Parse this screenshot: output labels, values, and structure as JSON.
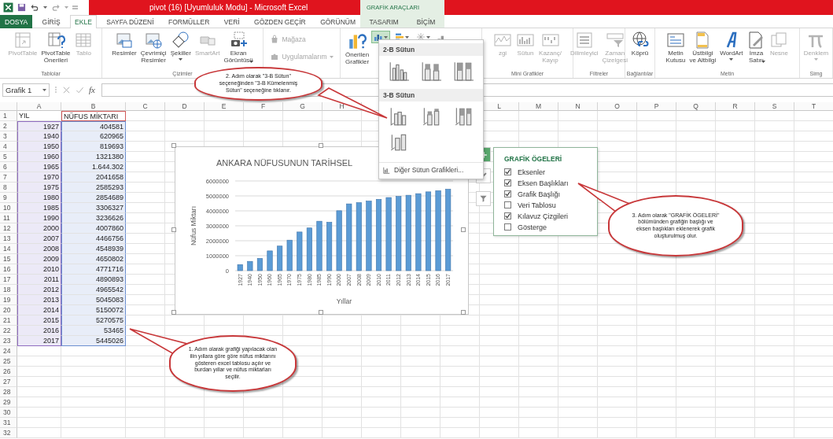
{
  "window": {
    "title": "pivot (16) [Uyumluluk Modu] - Microsoft Excel",
    "context_header": "GRAFİK ARAÇLARI"
  },
  "tabs": [
    {
      "label": "DOSYA",
      "kind": "file",
      "selected": false
    },
    {
      "label": "GİRİŞ",
      "kind": "normal",
      "selected": false
    },
    {
      "label": "EKLE",
      "kind": "normal",
      "selected": true
    },
    {
      "label": "SAYFA DÜZENİ",
      "kind": "normal",
      "selected": false
    },
    {
      "label": "FORMÜLLER",
      "kind": "normal",
      "selected": false
    },
    {
      "label": "VERİ",
      "kind": "normal",
      "selected": false
    },
    {
      "label": "GÖZDEN GEÇİR",
      "kind": "normal",
      "selected": false
    },
    {
      "label": "GÖRÜNÜM",
      "kind": "normal",
      "selected": false
    },
    {
      "label": "TASARIM",
      "kind": "contextual",
      "selected": false
    },
    {
      "label": "BİÇİM",
      "kind": "contextual",
      "selected": false
    }
  ],
  "ribbon": {
    "groups": [
      {
        "kind": "large",
        "label": "Tablolar",
        "buttons": [
          {
            "label": "PivotTable",
            "disabled": true,
            "dropdown": false
          },
          {
            "label": "PivotTable\nÖnerileri",
            "disabled": false,
            "dropdown": false
          },
          {
            "label": "Tablo",
            "disabled": true,
            "dropdown": false
          }
        ]
      },
      {
        "kind": "large",
        "label": "Çizimler",
        "buttons": [
          {
            "label": "Resimler",
            "disabled": false,
            "dropdown": false
          },
          {
            "label": "Çevrimiçi\nResimler",
            "disabled": false,
            "dropdown": false
          },
          {
            "label": "Şekiller",
            "disabled": false,
            "dropdown": true
          },
          {
            "label": "SmartArt",
            "disabled": true,
            "dropdown": false
          },
          {
            "label": "Ekran\nGörüntüsü",
            "disabled": false,
            "dropdown": true
          }
        ]
      },
      {
        "kind": "apps",
        "buttons": [
          {
            "label": "Mağaza",
            "disabled": true,
            "dropdown": false
          },
          {
            "label": "Uygulamalarım",
            "disabled": true,
            "dropdown": true
          }
        ]
      },
      {
        "kind": "charts",
        "buttons": [
          {
            "label": "Önerilen\nGrafikler",
            "disabled": false,
            "dropdown": false
          }
        ],
        "chart_buttons": [
          {
            "expanded": true
          },
          {
            "expanded": false
          },
          {
            "expanded": false
          }
        ]
      },
      {
        "kind": "large",
        "label": "Mini Grafikler",
        "buttons": [
          {
            "label": "zgi",
            "disabled": true,
            "dropdown": false
          },
          {
            "label": "Sütun",
            "disabled": true,
            "dropdown": false
          },
          {
            "label": "Kazanç/\nKayıp",
            "disabled": true,
            "dropdown": false
          }
        ]
      },
      {
        "kind": "large",
        "label": "Filtreler",
        "buttons": [
          {
            "label": "Dilimleyici",
            "disabled": true,
            "dropdown": false
          },
          {
            "label": "Zaman\nÇizelgesi",
            "disabled": true,
            "dropdown": false
          }
        ]
      },
      {
        "kind": "large",
        "label": "Bağlantılar",
        "buttons": [
          {
            "label": "Köprü",
            "disabled": false,
            "dropdown": false
          }
        ]
      },
      {
        "kind": "large",
        "label": "Metin",
        "buttons": [
          {
            "label": "Metin\nKutusu",
            "disabled": false,
            "dropdown": false
          },
          {
            "label": "Üstbilgi\nve Altbilgi",
            "disabled": false,
            "dropdown": false
          },
          {
            "label": "WordArt",
            "disabled": false,
            "dropdown": true
          },
          {
            "label": "İmza\nSatırı",
            "disabled": false,
            "dropdown": true
          },
          {
            "label": "Nesne",
            "disabled": true,
            "dropdown": false
          }
        ]
      },
      {
        "kind": "large",
        "label": "Simg",
        "buttons": [
          {
            "label": "Denklem",
            "disabled": true,
            "dropdown": true
          }
        ]
      }
    ]
  },
  "formula_bar": {
    "name_box": "Grafik 1",
    "fx_label": "fx"
  },
  "chart_menu": {
    "sections": [
      {
        "title": "2-B Sütun",
        "options": [
          {
            "kind": "clustered"
          },
          {
            "kind": "stacked"
          },
          {
            "kind": "full"
          }
        ]
      },
      {
        "title": "3-B Sütun",
        "options": [
          {
            "kind": "clustered3d"
          },
          {
            "kind": "stacked3d"
          },
          {
            "kind": "full3d"
          },
          {
            "kind": "column3d"
          }
        ]
      }
    ],
    "footer": "Diğer Sütun Grafikleri..."
  },
  "sheet": {
    "columns_left": [
      "A",
      "B",
      "C",
      "D",
      "E",
      "F",
      "G",
      "H"
    ],
    "columns_right": [
      "L",
      "M",
      "N",
      "O",
      "P",
      "Q",
      "R",
      "S",
      "T"
    ],
    "rows": [
      {
        "number": "1",
        "kind": "header",
        "highlighted": true,
        "cells": [
          "YIL",
          "NÜFUS MİKTARI"
        ]
      },
      {
        "number": "2",
        "kind": "data",
        "highlighted": true,
        "cells": [
          "1927",
          "404581"
        ]
      },
      {
        "number": "3",
        "kind": "data",
        "highlighted": true,
        "cells": [
          "1940",
          "620965"
        ]
      },
      {
        "number": "4",
        "kind": "data",
        "highlighted": true,
        "cells": [
          "1950",
          "819693"
        ]
      },
      {
        "number": "5",
        "kind": "data",
        "highlighted": true,
        "cells": [
          "1960",
          "1321380"
        ]
      },
      {
        "number": "6",
        "kind": "data",
        "highlighted": true,
        "cells": [
          "1965",
          "1.644.302"
        ]
      },
      {
        "number": "7",
        "kind": "data",
        "highlighted": true,
        "cells": [
          "1970",
          "2041658"
        ]
      },
      {
        "number": "8",
        "kind": "data",
        "highlighted": true,
        "cells": [
          "1975",
          "2585293"
        ]
      },
      {
        "number": "9",
        "kind": "data",
        "highlighted": true,
        "cells": [
          "1980",
          "2854689"
        ]
      },
      {
        "number": "10",
        "kind": "data",
        "highlighted": true,
        "cells": [
          "1985",
          "3306327"
        ]
      },
      {
        "number": "11",
        "kind": "data",
        "highlighted": true,
        "cells": [
          "1990",
          "3236626"
        ]
      },
      {
        "number": "12",
        "kind": "data",
        "highlighted": true,
        "cells": [
          "2000",
          "4007860"
        ]
      },
      {
        "number": "13",
        "kind": "data",
        "highlighted": true,
        "cells": [
          "2007",
          "4466756"
        ]
      },
      {
        "number": "14",
        "kind": "data",
        "highlighted": true,
        "cells": [
          "2008",
          "4548939"
        ]
      },
      {
        "number": "15",
        "kind": "data",
        "highlighted": true,
        "cells": [
          "2009",
          "4650802"
        ]
      },
      {
        "number": "16",
        "kind": "data",
        "highlighted": true,
        "cells": [
          "2010",
          "4771716"
        ]
      },
      {
        "number": "17",
        "kind": "data",
        "highlighted": true,
        "cells": [
          "2011",
          "4890893"
        ]
      },
      {
        "number": "18",
        "kind": "data",
        "highlighted": true,
        "cells": [
          "2012",
          "4965542"
        ]
      },
      {
        "number": "19",
        "kind": "data",
        "highlighted": true,
        "cells": [
          "2013",
          "5045083"
        ]
      },
      {
        "number": "20",
        "kind": "data",
        "highlighted": true,
        "cells": [
          "2014",
          "5150072"
        ]
      },
      {
        "number": "21",
        "kind": "data",
        "highlighted": true,
        "cells": [
          "2015",
          "5270575"
        ]
      },
      {
        "number": "22",
        "kind": "data",
        "highlighted": true,
        "cells": [
          "2016",
          "53465"
        ]
      },
      {
        "number": "23",
        "kind": "data",
        "highlighted": true,
        "cells": [
          "2017",
          "5445026"
        ]
      },
      {
        "number": "24",
        "kind": "empty",
        "highlighted": false
      },
      {
        "number": "25",
        "kind": "empty",
        "highlighted": false
      },
      {
        "number": "26",
        "kind": "empty",
        "highlighted": false
      },
      {
        "number": "27",
        "kind": "empty",
        "highlighted": false
      },
      {
        "number": "28",
        "kind": "empty",
        "highlighted": false
      },
      {
        "number": "29",
        "kind": "empty",
        "highlighted": false
      },
      {
        "number": "30",
        "kind": "empty",
        "highlighted": false
      },
      {
        "number": "31",
        "kind": "empty",
        "highlighted": false
      },
      {
        "number": "32",
        "kind": "empty",
        "highlighted": false
      }
    ]
  },
  "chart": {
    "chart_data": {
      "type": "bar",
      "title": "ANKARA NÜFUSUNUN TARİHSEL",
      "xlabel": "Yıllar",
      "ylabel": "Nüfus Miktarı",
      "categories": [
        "1927",
        "1940",
        "1950",
        "1960",
        "1965",
        "1970",
        "1975",
        "1980",
        "1985",
        "1990",
        "2000",
        "2007",
        "2008",
        "2009",
        "2010",
        "2011",
        "2012",
        "2013",
        "2014",
        "2015",
        "2016",
        "2017"
      ],
      "series": [
        {
          "color": "#5b9bd5",
          "values": [
            404581,
            620965,
            819693,
            1321380,
            1644302,
            2041658,
            2585293,
            2854689,
            3306327,
            3236626,
            4007860,
            4466756,
            4548939,
            4650802,
            4771716,
            4890893,
            4965542,
            5045083,
            5150072,
            5270575,
            5346518,
            5445026
          ]
        }
      ],
      "ylim": [
        0,
        6000000
      ],
      "grid": true,
      "yticks": [
        0,
        1000000,
        2000000,
        3000000,
        4000000,
        5000000,
        6000000
      ]
    }
  },
  "chart_elements": {
    "title": "GRAFİK ÖGELERİ",
    "items": [
      {
        "label": "Eksenler",
        "checked": true
      },
      {
        "label": "Eksen Başlıkları",
        "checked": true
      },
      {
        "label": "Grafik Başlığı",
        "checked": true
      },
      {
        "label": "Veri Tablosu",
        "checked": false
      },
      {
        "label": "Kılavuz Çizgileri",
        "checked": true
      },
      {
        "label": "Gösterge",
        "checked": false
      }
    ]
  },
  "callouts": [
    {
      "text": "1. Adım olarak grafiği yapılacak olan ilin yıllara göre göre nüfus miktarını gösteren excel tablosu açılır ve burdan yıllar ve nüfus miktarları seçilir."
    },
    {
      "text": "2. Adım olarak \"3-B Sütun\" seçeneğinden \"3-B Kümelenmiş Sütun\" seçeneğine tıklanır."
    },
    {
      "text": "3. Adım olarak \"GRAFİK ÖGELERİ\" bölümünden grafiğin başlığı ve eksen başlıkları eklenerek grafik oluşturulmuş olur."
    }
  ]
}
